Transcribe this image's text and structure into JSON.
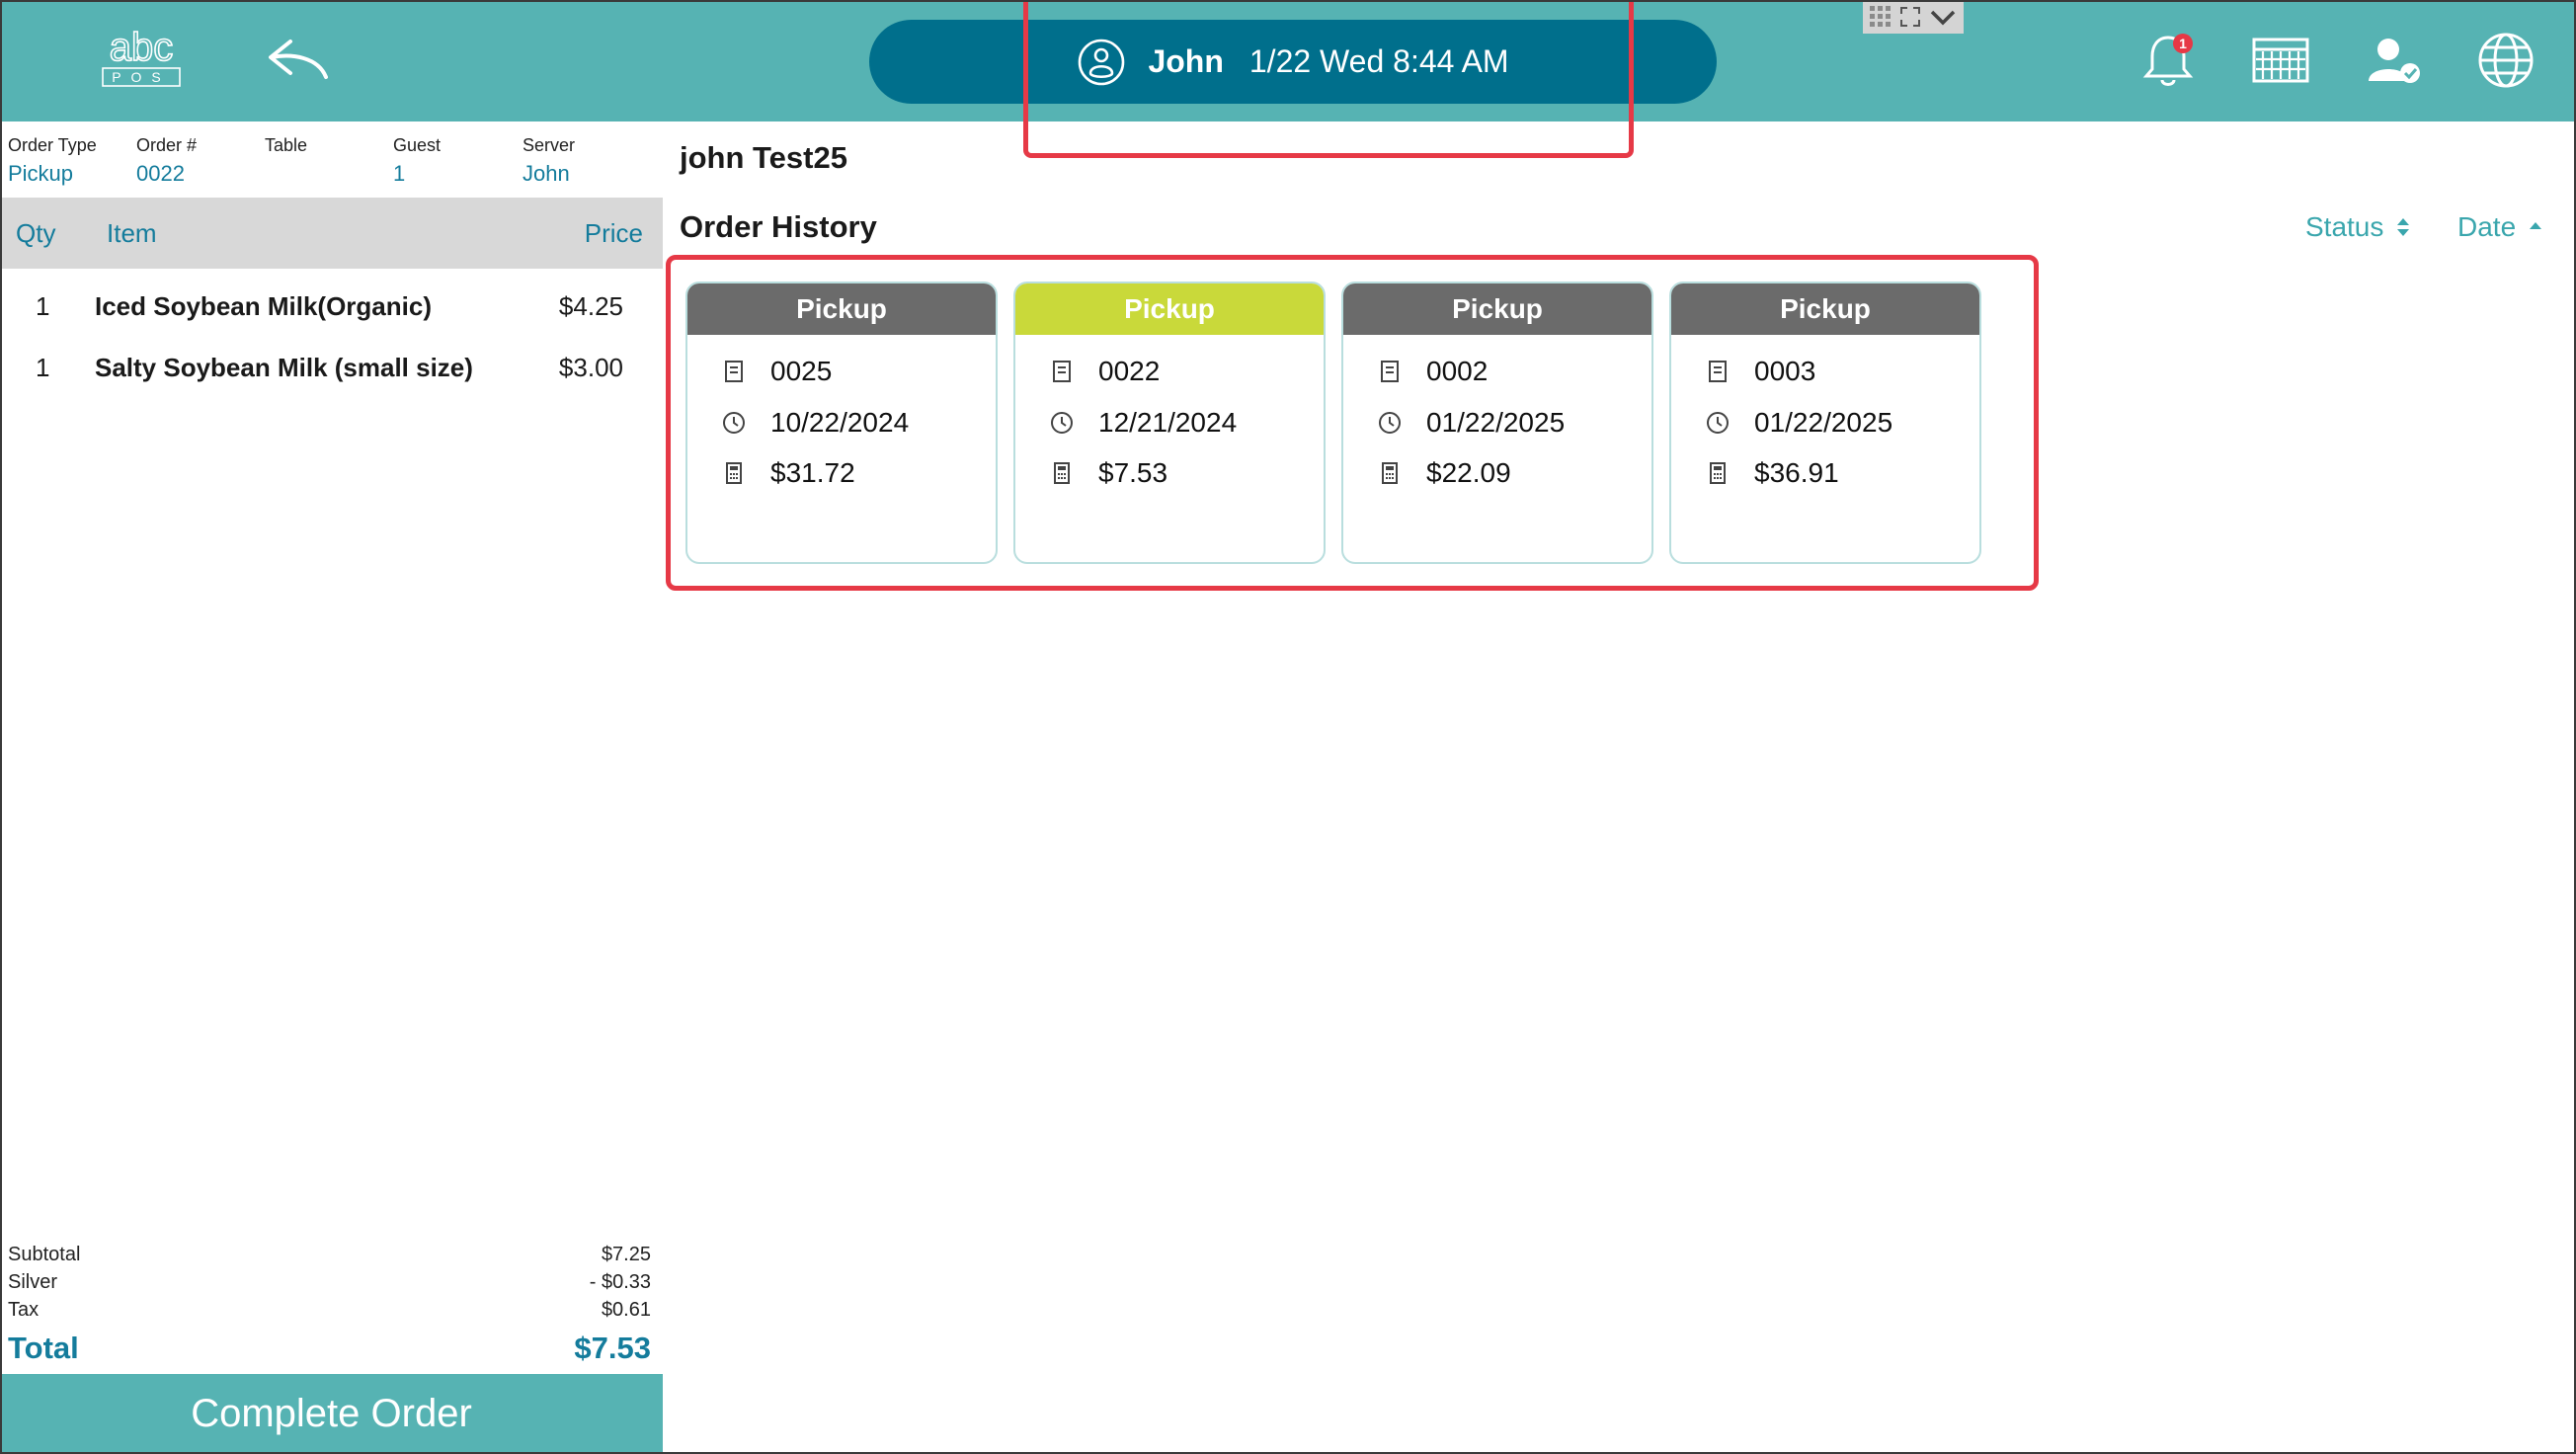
{
  "header": {
    "logo_letters": "abc",
    "logo_sub": "POS",
    "user": "John",
    "datetime": "1/22 Wed 8:44 AM",
    "notification_count": "1",
    "accent": "#56b3b3",
    "pill_color": "#006f8c"
  },
  "order_meta": {
    "order_type_label": "Order Type",
    "order_type": "Pickup",
    "order_no_label": "Order #",
    "order_no": "0022",
    "table_label": "Table",
    "table": "",
    "guest_label": "Guest",
    "guest": "1",
    "server_label": "Server",
    "server": "John"
  },
  "grid": {
    "qty_label": "Qty",
    "item_label": "Item",
    "price_label": "Price"
  },
  "items": [
    {
      "qty": "1",
      "name": "Iced Soybean Milk(Organic)",
      "price": "$4.25"
    },
    {
      "qty": "1",
      "name": "Salty Soybean Milk (small size)",
      "price": "$3.00"
    }
  ],
  "totals": {
    "subtotal_label": "Subtotal",
    "subtotal": "$7.25",
    "discount_label": "Silver",
    "discount": "- $0.33",
    "tax_label": "Tax",
    "tax": "$0.61",
    "total_label": "Total",
    "total": "$7.53"
  },
  "complete_label": "Complete Order",
  "customer_name": "john Test25",
  "order_history_title": "Order History",
  "sort": {
    "status_label": "Status",
    "date_label": "Date"
  },
  "history": [
    {
      "type": "Pickup",
      "order_no": "0025",
      "date": "10/22/2024",
      "amount": "$31.72",
      "active": false
    },
    {
      "type": "Pickup",
      "order_no": "0022",
      "date": "12/21/2024",
      "amount": "$7.53",
      "active": true
    },
    {
      "type": "Pickup",
      "order_no": "0002",
      "date": "01/22/2025",
      "amount": "$22.09",
      "active": false
    },
    {
      "type": "Pickup",
      "order_no": "0003",
      "date": "01/22/2025",
      "amount": "$36.91",
      "active": false
    }
  ],
  "icons": {
    "logo": "abc-pos-logo",
    "back": "back-arrow-icon",
    "user": "user-icon",
    "bell": "bell-icon",
    "calendar": "calendar-grid-icon",
    "staff": "user-check-icon",
    "globe": "globe-icon",
    "receipt": "receipt-icon",
    "clock": "clock-icon",
    "calculator": "calculator-icon"
  }
}
